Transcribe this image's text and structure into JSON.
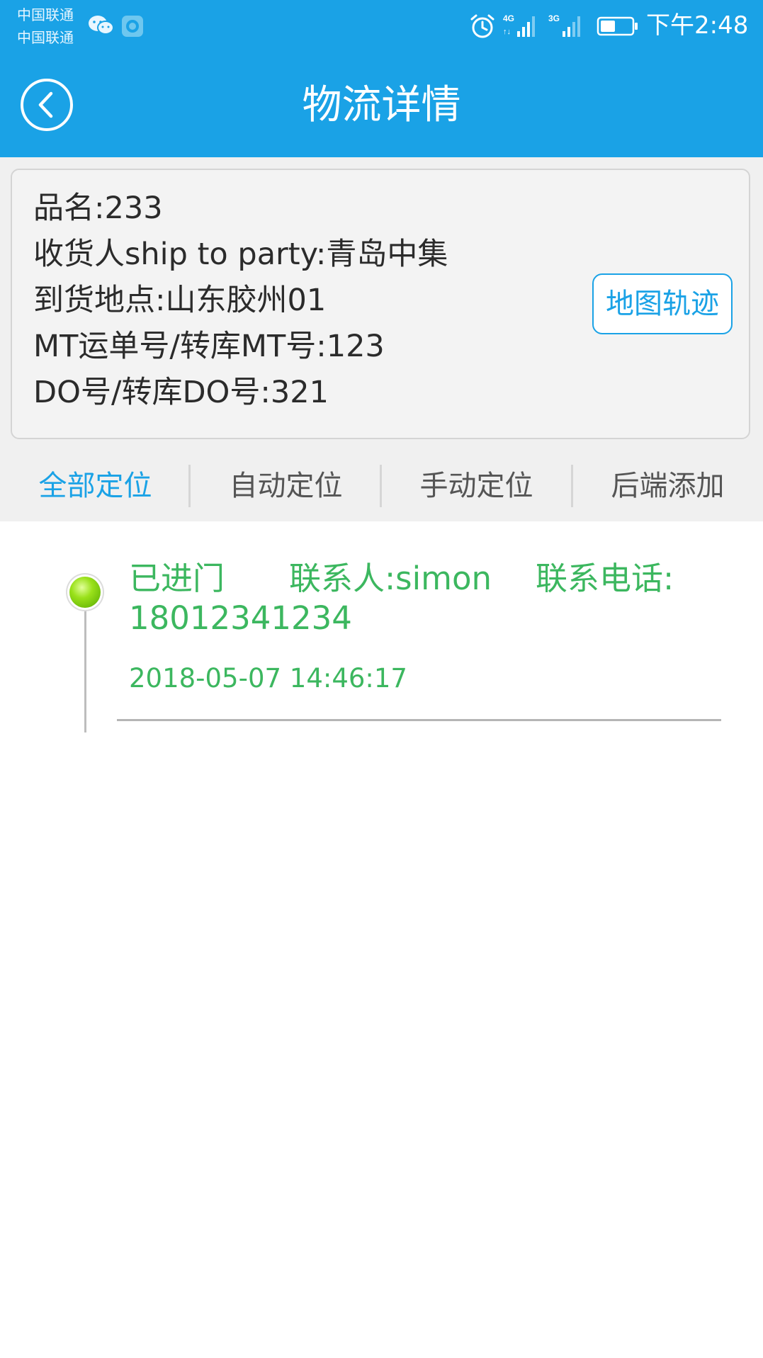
{
  "status_bar": {
    "carrier_1": "中国联通",
    "carrier_2": "中国联通",
    "signal_1_type": "4G",
    "signal_2_type": "3G",
    "time": "下午2:48",
    "icons": [
      "wechat-icon",
      "shield-icon",
      "alarm-icon",
      "signal-4g-icon",
      "signal-3g-icon",
      "battery-icon"
    ]
  },
  "header": {
    "title": "物流详情",
    "back_icon": "back-circle-icon",
    "background_color": "#1aa2e6"
  },
  "shipment": {
    "product_name": "品名:233",
    "consignee": "收货人ship to party:青岛中集",
    "destination": "到货地点:山东胶州01",
    "mt_number": "MT运单号/转库MT号:123",
    "do_number": "DO号/转库DO号:321",
    "map_button_label": "地图轨迹"
  },
  "tabs": [
    {
      "label": "全部定位",
      "active": true
    },
    {
      "label": "自动定位",
      "active": false
    },
    {
      "label": "手动定位",
      "active": false
    },
    {
      "label": "后端添加",
      "active": false
    }
  ],
  "timeline": [
    {
      "status": "已进门",
      "contact": "联系人:simon",
      "phone_label": "联系电话:",
      "phone": "18012341234",
      "time": "2018-05-07 14:46:17"
    }
  ],
  "colors": {
    "accent": "#1aa2e6",
    "success_text": "#3cb75f",
    "dot": "#8fd81a"
  }
}
